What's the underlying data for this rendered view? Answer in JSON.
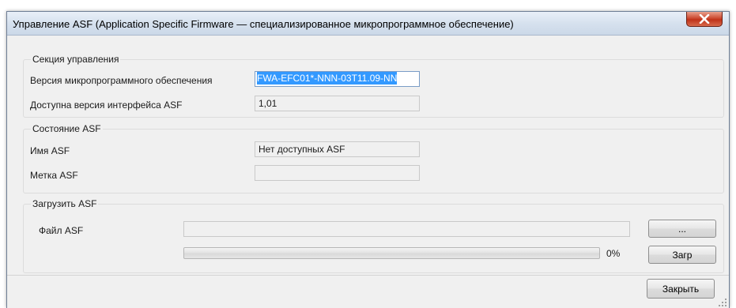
{
  "window": {
    "title": "Управление ASF (Application Specific Firmware — специализированное микропрограммное обеспечение)"
  },
  "control_section": {
    "label": "Секция управления",
    "firmware_version_label": "Версия микропрограммного обеспечения",
    "firmware_version_value": "FWA-EFC01*-NNN-03T11.09-NN",
    "interface_version_label": "Доступна версия интерфейса ASF",
    "interface_version_value": "1,01"
  },
  "asf_state": {
    "label": "Состояние ASF",
    "name_label": "Имя ASF",
    "name_value": "Нет доступных ASF",
    "tag_label": "Метка ASF",
    "tag_value": ""
  },
  "load_asf": {
    "label": "Загрузить ASF",
    "file_label": "Файл ASF",
    "file_value": "",
    "browse_label": "...",
    "progress_percent": 0,
    "progress_text": "0%",
    "load_button_label": "Загр"
  },
  "footer": {
    "close_button_label": "Закрыть"
  },
  "icons": {
    "close": "close-x-icon",
    "grip": "resize-grip-icon"
  },
  "colors": {
    "selection": "#3399ff",
    "close_button": "#c94a33"
  }
}
